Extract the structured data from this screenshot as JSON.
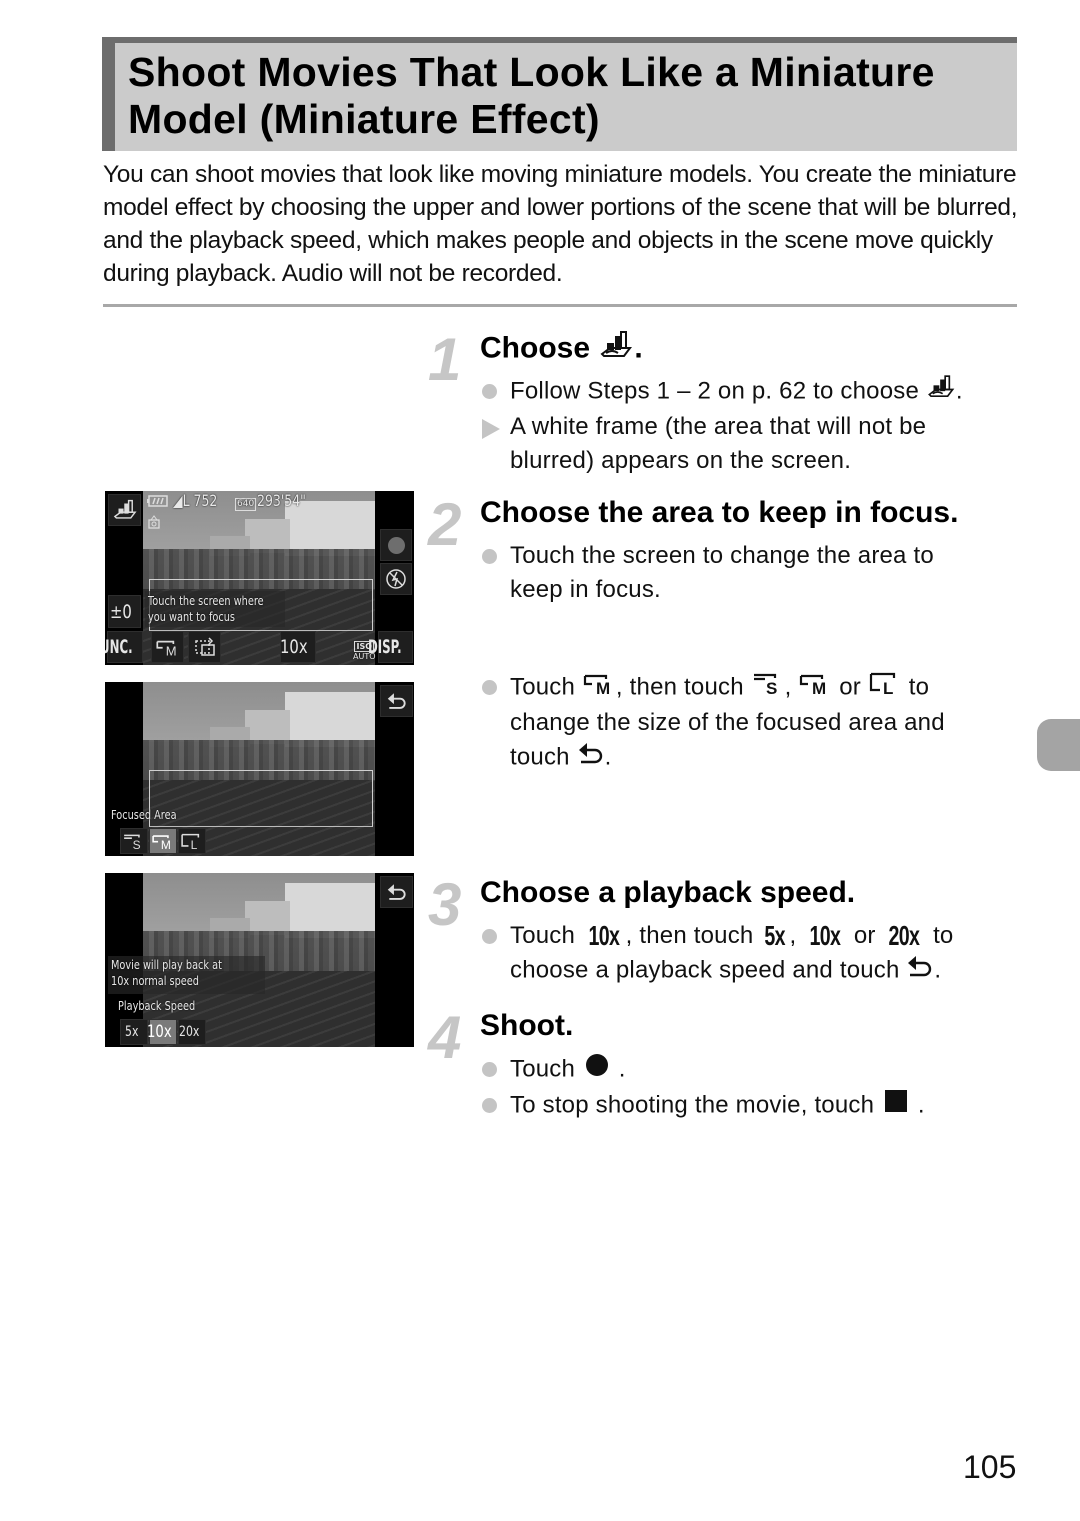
{
  "page": {
    "title": "Shoot Movies That Look Like a Miniature Model (Miniature Effect)",
    "title_line1": "Shoot Movies That Look Like a Miniature",
    "title_line2": "Model (Miniature Effect)",
    "intro": "You can shoot movies that look like moving miniature models. You create the miniature model effect by choosing the upper and lower portions of the scene that will be blurred, and the playback speed, which makes people and objects in the scene move quickly during playback. Audio will not be recorded.",
    "page_number": "105"
  },
  "colors": {
    "title_bg": "#cbcbcb",
    "title_border": "#6d6d6d",
    "step_number": "#c6c6c6",
    "bullet": "#c4c4c4",
    "thumb_tab": "#a4a4a4"
  },
  "steps": [
    {
      "number": "1",
      "title_prefix": "Choose",
      "title_icon": "miniature-effect-icon",
      "title_suffix": ".",
      "bullets": [
        {
          "type": "dot",
          "text_before": "Follow Steps 1 – 2 on p. 62 to choose",
          "icon": "miniature-effect-icon",
          "text_after": "."
        },
        {
          "type": "arrow",
          "text": "A white frame (the area that will not be blurred) appears on the screen.",
          "line1": "A white frame (the area that will not be",
          "line2": "blurred) appears on the screen."
        }
      ]
    },
    {
      "number": "2",
      "title": "Choose the area to keep in focus.",
      "bullets": [
        {
          "type": "dot",
          "line1": "Touch the screen to change the area to",
          "line2": "keep in focus."
        },
        {
          "type": "dot",
          "t1": "Touch",
          "t2": ", then touch",
          "t3": ",",
          "t4": "or",
          "t5": "to",
          "line2": "change the size of the focused area and",
          "line3_prefix": "touch",
          "line3_suffix": ".",
          "icons": [
            "focus-area-medium-icon",
            "focus-area-small-icon",
            "focus-area-medium-icon",
            "focus-area-large-icon",
            "return-icon"
          ]
        }
      ]
    },
    {
      "number": "3",
      "title": "Choose a playback speed.",
      "bullets": [
        {
          "type": "dot",
          "t1": "Touch",
          "s1": "10x",
          "t2": ", then touch",
          "s2": "5x",
          "t3": ",",
          "s3": "10x",
          "t4": "or",
          "s4": "20x",
          "t5": "to",
          "line2_prefix": "choose a playback speed and touch",
          "line2_suffix": "."
        }
      ]
    },
    {
      "number": "4",
      "title": "Shoot.",
      "bullets": [
        {
          "type": "dot",
          "text_before": "Touch",
          "icon": "record-icon",
          "text_after": "."
        },
        {
          "type": "dot",
          "text_before": "To stop shooting the movie, touch",
          "icon": "stop-icon",
          "text_after": "."
        }
      ]
    }
  ],
  "screens": {
    "screen1": {
      "shots_remaining": "752",
      "quality": "L",
      "time_remaining": "293'54\"",
      "exposure": "±0",
      "hint_line1": "Touch the screen where",
      "hint_line2": "you want to focus",
      "func_label": "FUNC.",
      "disp_label": "DISP.",
      "speed_label": "10x",
      "focus_size_label": "M",
      "iso_label": "ISO",
      "iso_sub": "AUTO"
    },
    "screen2": {
      "label": "Focused Area",
      "options": [
        "S",
        "M",
        "L"
      ],
      "selected": "M"
    },
    "screen3": {
      "message_line1": "Movie will play back at",
      "message_line2": "10x normal speed",
      "label": "Playback Speed",
      "options": [
        "5x",
        "10x",
        "20x"
      ],
      "selected": "10x"
    }
  }
}
